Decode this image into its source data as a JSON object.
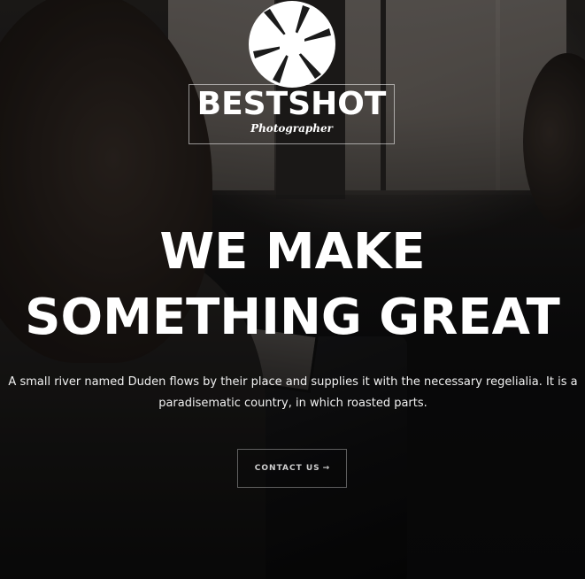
{
  "brand": {
    "logo_icon": "camera-aperture-icon",
    "name": "BESTSHOT",
    "tagline": "Photographer"
  },
  "hero": {
    "headline_line1": "WE MAKE",
    "headline_line2": "SOMETHING GREAT",
    "description": "A small river named Duden flows by their place and supplies it with the necessary regelialia. It is a paradisematic country, in which roasted parts.",
    "cta_label": "CONTACT US",
    "cta_arrow": "→"
  },
  "colors": {
    "text": "#ffffff",
    "overlay": "#000000",
    "cta_text": "#cfcfcf"
  }
}
